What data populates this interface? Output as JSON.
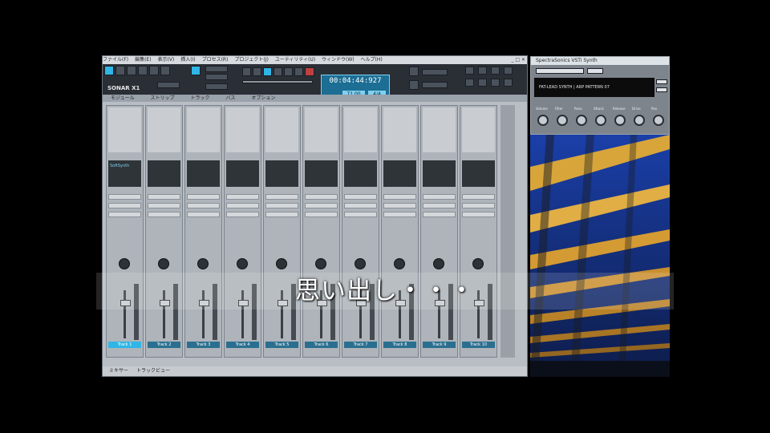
{
  "daw": {
    "menu": [
      "ファイル(F)",
      "編集(E)",
      "表示(V)",
      "挿入(I)",
      "プロセス(R)",
      "プロジェクト(J)",
      "ユーティリティ(U)",
      "ウィンドウ(W)",
      "ヘルプ(H)"
    ],
    "logo": "SONAR X1",
    "timecode": "00:04:44:927",
    "tempo": "71.00",
    "meter": "4/4",
    "modebar": [
      "モジュール",
      "ストリップ",
      "トラック",
      "バス",
      "オプション"
    ],
    "strips": [
      {
        "name": "Track 1",
        "selected": true,
        "fx": "SoftSynth"
      },
      {
        "name": "Track 2",
        "selected": false,
        "fx": ""
      },
      {
        "name": "Track 3",
        "selected": false,
        "fx": ""
      },
      {
        "name": "Track 4",
        "selected": false,
        "fx": ""
      },
      {
        "name": "Track 5",
        "selected": false,
        "fx": ""
      },
      {
        "name": "Track 6",
        "selected": false,
        "fx": ""
      },
      {
        "name": "Track 7",
        "selected": false,
        "fx": ""
      },
      {
        "name": "Track 8",
        "selected": false,
        "fx": ""
      },
      {
        "name": "Track 9",
        "selected": false,
        "fx": ""
      },
      {
        "name": "Track 10",
        "selected": false,
        "fx": ""
      }
    ],
    "status": [
      "ミキサー",
      "トラックビュー"
    ]
  },
  "plugin": {
    "title": "SpectraSonics VSTi Synth",
    "knobs": [
      "Volume",
      "Filter",
      "Reso",
      "Attack",
      "Release",
      "Drive",
      "Pan"
    ],
    "display": "FAT-LEAD SYNTH | ARP PATTERN 07"
  },
  "subtitle": "思い出し・・・",
  "colors": {
    "accent": "#2fb6e6",
    "bg": "#000000"
  }
}
